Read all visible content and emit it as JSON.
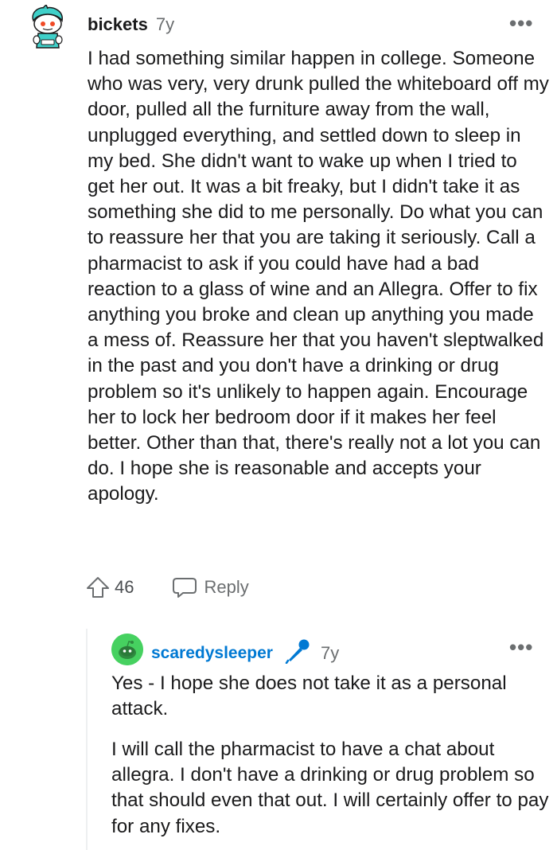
{
  "top_comment": {
    "author": "bickets",
    "age": "7y",
    "body": "I had something similar happen in college. Someone who was very, very drunk pulled the whiteboard off my door, pulled all the furniture away from the wall, unplugged everything, and settled down to sleep in my bed. She didn't want to wake up when I tried to get her out. It was a bit freaky, but I didn't take it as something she did to me personally. Do what you can to reassure her that you are taking it seriously. Call a pharmacist to ask if you could have had a bad reaction to a glass of wine and an Allegra. Offer to fix anything you broke and clean up anything you made a mess of. Reassure her that you haven't sleptwalked in the past and you don't have a drinking or drug problem so it's unlikely to happen again. Encourage her to lock her bedroom door if it makes her feel better. Other than that, there's really not a lot you can do. I hope she is reasonable and accepts your apology.",
    "score": "46",
    "reply_label": "Reply",
    "more_label": "•••",
    "avatar_icon": "reddit-snoo-avatar-icon"
  },
  "reply_comment": {
    "author": "scaredysleeper",
    "age": "7y",
    "op_badge_icon": "microphone-icon",
    "paragraph_1": "Yes - I hope she does not take it as a personal attack.",
    "paragraph_2": "I will call the pharmacist to have a chat about allegra. I don't have a drinking or drug problem so that should even that out. I will certainly offer to pay for any fixes.",
    "more_label": "•••",
    "avatar_icon": "reddit-snoo-avatar-icon"
  },
  "colors": {
    "op_author": "#0079d3",
    "meta_gray": "#6b6e70",
    "avatar_green": "#46d160",
    "avatar_teal": "#3fd0c9"
  }
}
